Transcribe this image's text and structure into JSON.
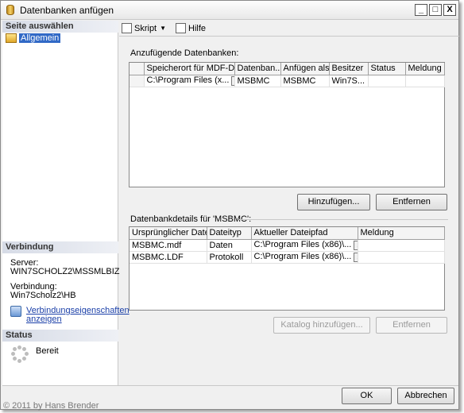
{
  "window": {
    "title": "Datenbanken anfügen",
    "minimize": "_",
    "maximize": "□",
    "close": "X"
  },
  "left": {
    "select_page_header": "Seite auswählen",
    "nav_items": [
      {
        "label": "Allgemein",
        "icon": "page-icon"
      }
    ],
    "connection_header": "Verbindung",
    "server_label": "Server:",
    "server_value": "WIN7SCHOLZ2\\MSSMLBIZ",
    "connection_label": "Verbindung:",
    "connection_value": "Win7Scholz2\\HB",
    "properties_link": "Verbindungseigenschaften anzeigen",
    "status_header": "Status",
    "status_value": "Bereit"
  },
  "toolbar": {
    "script_label": "Skript",
    "help_label": "Hilfe"
  },
  "attach": {
    "label": "Anzufügende Datenbanken:",
    "columns": [
      "",
      "Speicherort für MDF-Datei",
      "Datenban...",
      "Anfügen als",
      "Besitzer",
      "Status",
      "Meldung"
    ],
    "rows": [
      {
        "mdf_location": "C:\\Program Files (x...",
        "browse": "...",
        "database": "MSBMC",
        "attach_as": "MSBMC",
        "owner": "Win7S...",
        "status": "",
        "message": ""
      }
    ],
    "add_button": "Hinzufügen...",
    "remove_button": "Entfernen"
  },
  "details": {
    "label": "Datenbankdetails für 'MSBMC':",
    "columns": [
      "Ursprünglicher Datei...",
      "Dateityp",
      "Aktueller Dateipfad",
      "Meldung"
    ],
    "rows": [
      {
        "file": "MSBMC.mdf",
        "type": "Daten",
        "path": "C:\\Program Files (x86)\\...",
        "browse": "...",
        "message": ""
      },
      {
        "file": "MSBMC.LDF",
        "type": "Protokoll",
        "path": "C:\\Program Files (x86)\\...",
        "browse": "...",
        "message": ""
      }
    ],
    "add_catalog_button": "Katalog hinzufügen...",
    "remove_button": "Entfernen"
  },
  "footer": {
    "ok_button": "OK",
    "cancel_button": "Abbrechen"
  },
  "watermark": "© 2011 by Hans Brender"
}
